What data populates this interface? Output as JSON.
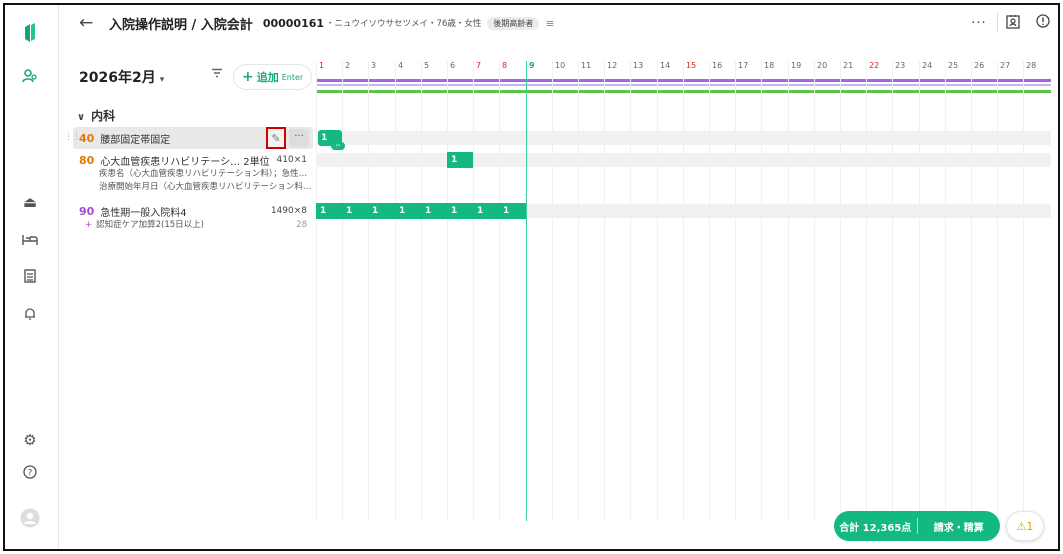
{
  "header": {
    "back_icon": "arrow-left-icon",
    "title": "入院操作説明 / 入院会計",
    "patient_id": "00000161",
    "patient_info": "・ニュウイソウサセツメイ・76歳・女性",
    "badge": "後期高齢者",
    "more_label": "···"
  },
  "toolbar": {
    "month": "2026年2月",
    "add_label": "追加",
    "add_shortcut": "Enter"
  },
  "category": {
    "label": "内科"
  },
  "orders": [
    {
      "code": "40",
      "name": "腰部固定帯固定",
      "color": "#e07a00"
    },
    {
      "code": "80",
      "name": "心大血管疾患リハビリテーシ…  2単位",
      "qty": "410×1",
      "sub1": "疾患名（心大血管疾患リハビリテーション料）；急性…",
      "sub2": "治療開始年月日（心大血管疾患リハビリテーション料…",
      "color": "#e07a00"
    },
    {
      "code": "90",
      "name": "急性期一般入院料4",
      "qty": "1490×8",
      "addon": "認知症ケア加算2(15日以上)",
      "addon_qty": "28",
      "color": "#a34bd2"
    }
  ],
  "calendar": {
    "days": [
      "1",
      "2",
      "3",
      "4",
      "5",
      "6",
      "7",
      "8",
      "9",
      "10",
      "11",
      "12",
      "13",
      "14",
      "15",
      "16",
      "17",
      "18",
      "19",
      "20",
      "21",
      "22",
      "23",
      "24",
      "25",
      "26",
      "27",
      "28"
    ],
    "red_days": [
      1,
      7,
      8,
      15,
      22
    ],
    "today": 9,
    "bar_label": "1"
  },
  "footer": {
    "total_label": "合計 12,365点",
    "pay_label": "請求・精算",
    "warning_label": "⚠1"
  },
  "colors": {
    "accent": "#14b982",
    "order_orange": "#e07a00",
    "order_purple": "#a34bd2",
    "highlight_box": "#d40000"
  }
}
